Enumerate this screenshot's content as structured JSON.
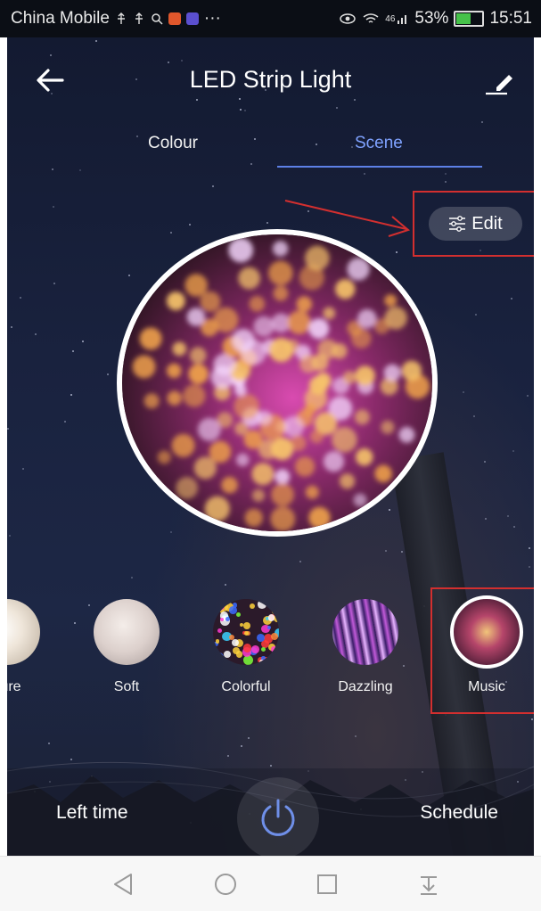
{
  "status_bar": {
    "carrier": "China Mobile",
    "extra_icons": [
      "usb-icon",
      "usb-icon",
      "search-icon",
      "app-icon",
      "video-icon"
    ],
    "ellipsis": "···",
    "network": "46",
    "battery": "53%",
    "time": "15:51",
    "battery_level": 0.53
  },
  "header": {
    "title": "LED Strip Light"
  },
  "tabs": [
    {
      "label": "Colour",
      "active": false
    },
    {
      "label": "Scene",
      "active": true
    }
  ],
  "edit_button": {
    "label": "Edit"
  },
  "scenes": [
    {
      "label": "sure"
    },
    {
      "label": "Soft"
    },
    {
      "label": "Colorful"
    },
    {
      "label": "Dazzling"
    },
    {
      "label": "Music",
      "selected": true
    }
  ],
  "bottom_bar": {
    "left_time_label": "Left time",
    "schedule_label": "Schedule"
  },
  "colors": {
    "accent": "#7fa2ff",
    "annotation_red": "#d32f2f",
    "background": "#1a2340"
  }
}
